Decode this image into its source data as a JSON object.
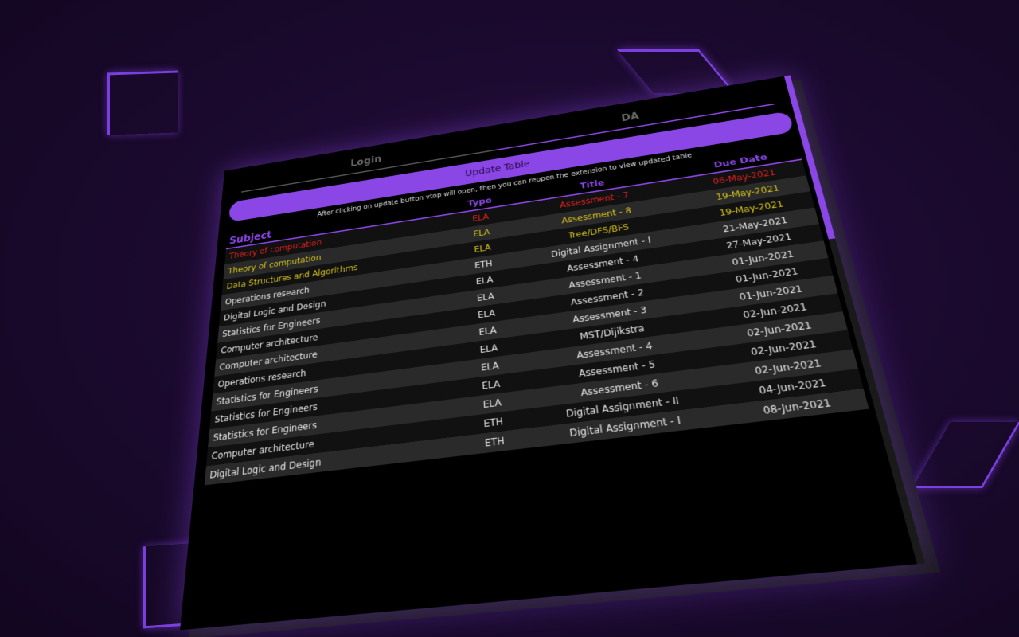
{
  "tabs": [
    {
      "label": "Login"
    },
    {
      "label": "DA"
    }
  ],
  "update_button": "Update Table",
  "hint": "After clicking on update button vtop will open, then you can reopen the extension to view updated table",
  "table": {
    "headers": {
      "subject": "Subject",
      "type": "Type",
      "title": "Title",
      "due": "Due Date"
    },
    "rows": [
      {
        "subject": "Theory of computation",
        "type": "ELA",
        "title": "Assessment - 7",
        "due": "06-May-2021",
        "color": "#e02020"
      },
      {
        "subject": "Theory of computation",
        "type": "ELA",
        "title": "Assessment - 8",
        "due": "19-May-2021",
        "color": "#d4c21a"
      },
      {
        "subject": "Data Structures and Algorithms",
        "type": "ELA",
        "title": "Tree/DFS/BFS",
        "due": "19-May-2021",
        "color": "#d4c21a"
      },
      {
        "subject": "Operations research",
        "type": "ETH",
        "title": "Digital Assignment - I",
        "due": "21-May-2021",
        "color": "#e6e6e6"
      },
      {
        "subject": "Digital Logic and Design",
        "type": "ELA",
        "title": "Assessment - 4",
        "due": "27-May-2021",
        "color": "#e6e6e6"
      },
      {
        "subject": "Statistics for Engineers",
        "type": "ELA",
        "title": "Assessment - 1",
        "due": "01-Jun-2021",
        "color": "#e6e6e6"
      },
      {
        "subject": "Computer architecture",
        "type": "ELA",
        "title": "Assessment - 2",
        "due": "01-Jun-2021",
        "color": "#e6e6e6"
      },
      {
        "subject": "Computer architecture",
        "type": "ELA",
        "title": "Assessment - 3",
        "due": "01-Jun-2021",
        "color": "#e6e6e6"
      },
      {
        "subject": "Operations research",
        "type": "ELA",
        "title": "MST/Dijikstra",
        "due": "02-Jun-2021",
        "color": "#e6e6e6"
      },
      {
        "subject": "Statistics for Engineers",
        "type": "ELA",
        "title": "Assessment - 4",
        "due": "02-Jun-2021",
        "color": "#e6e6e6"
      },
      {
        "subject": "Statistics for Engineers",
        "type": "ELA",
        "title": "Assessment - 5",
        "due": "02-Jun-2021",
        "color": "#e6e6e6"
      },
      {
        "subject": "Statistics for Engineers",
        "type": "ELA",
        "title": "Assessment - 6",
        "due": "02-Jun-2021",
        "color": "#e6e6e6"
      },
      {
        "subject": "Computer architecture",
        "type": "ETH",
        "title": "Digital Assignment - II",
        "due": "04-Jun-2021",
        "color": "#e6e6e6"
      },
      {
        "subject": "Digital Logic and Design",
        "type": "ETH",
        "title": "Digital Assignment - I",
        "due": "08-Jun-2021",
        "color": "#e6e6e6"
      }
    ]
  },
  "colors": {
    "accent": "#8b46e6",
    "overdue": "#e02020",
    "soon": "#d4c21a"
  }
}
